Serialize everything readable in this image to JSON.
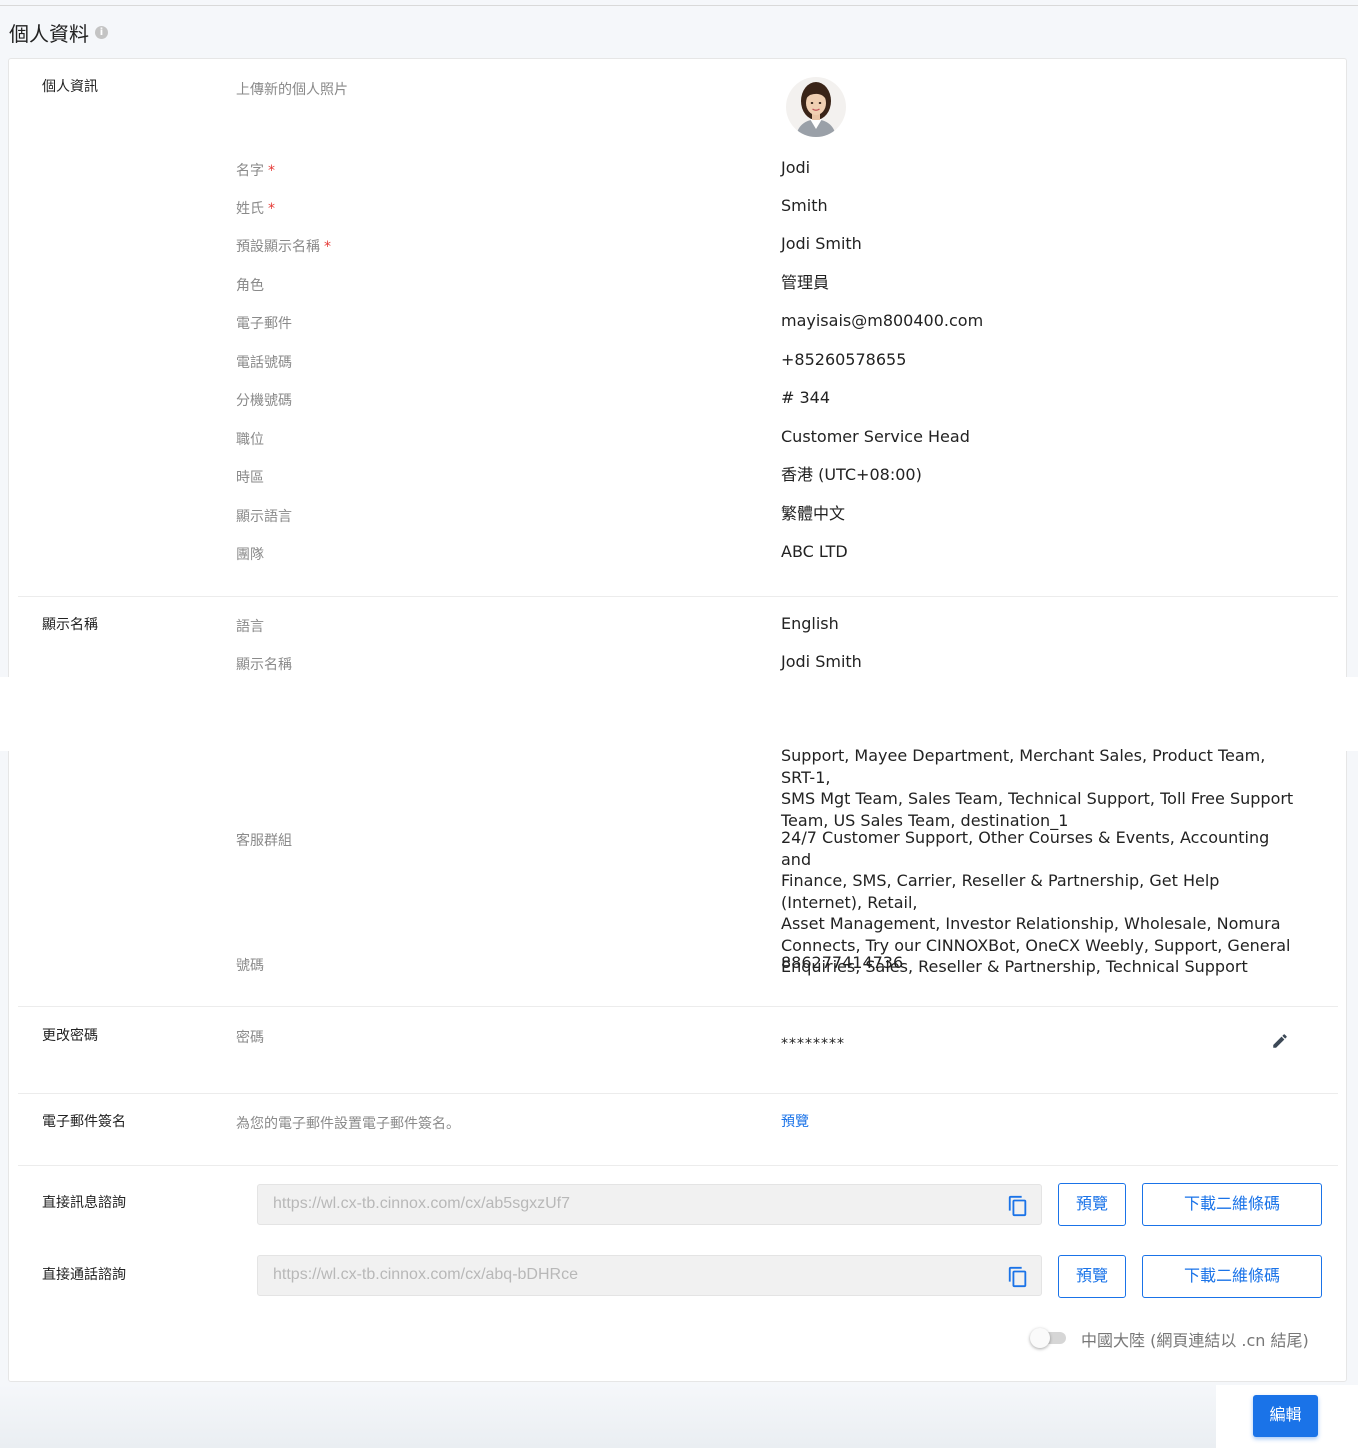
{
  "page": {
    "title": "個人資料"
  },
  "personal": {
    "section": "個人資訊",
    "photo_label": "上傳新的個人照片",
    "rows": [
      {
        "label": "名字",
        "value": "Jodi",
        "required": true
      },
      {
        "label": "姓氏",
        "value": "Smith",
        "required": true
      },
      {
        "label": "預設顯示名稱",
        "value": "Jodi Smith",
        "required": true
      },
      {
        "label": "角色",
        "value": "管理員",
        "required": false
      },
      {
        "label": "電子郵件",
        "value": "mayisais@m800400.com",
        "required": false
      },
      {
        "label": "電話號碼",
        "value": "+85260578655",
        "required": false
      },
      {
        "label": "分機號碼",
        "value": "# 344",
        "required": false
      },
      {
        "label": "職位",
        "value": "Customer Service Head",
        "required": false
      },
      {
        "label": "時區",
        "value": "香港 (UTC+08:00)",
        "required": false
      },
      {
        "label": "顯示語言",
        "value": "繁體中文",
        "required": false
      },
      {
        "label": "團隊",
        "value": "ABC LTD",
        "required": false
      }
    ],
    "required_mark": "*"
  },
  "display_name": {
    "section": "顯示名稱",
    "rows": [
      {
        "label": "語言",
        "value": "English"
      },
      {
        "label": "顯示名稱",
        "value": "Jodi Smith"
      }
    ]
  },
  "teams_continued": {
    "lines": [
      "Support, Mayee Department, Merchant Sales, Product Team, SRT-1,",
      "SMS Mgt Team, Sales Team, Technical Support, Toll Free Support",
      "Team, US Sales Team, destination_1"
    ]
  },
  "service_groups": {
    "label": "客服群組",
    "lines": [
      "24/7 Customer Support, Other Courses & Events, Accounting and",
      "Finance, SMS, Carrier, Reseller & Partnership, Get Help (Internet), Retail,",
      "Asset Management, Investor Relationship, Wholesale, Nomura",
      "Connects, Try our CINNOXBot, OneCX Weebly, Support, General",
      "Enquiries, Sales, Reseller & Partnership, Technical Support"
    ]
  },
  "number": {
    "label": "號碼",
    "value": "886277414736"
  },
  "password": {
    "section": "更改密碼",
    "label": "密碼",
    "value": "********",
    "edit_icon": "pencil-icon"
  },
  "signature": {
    "section": "電子郵件簽名",
    "description": "為您的電子郵件設置電子郵件簽名。",
    "preview": "預覽"
  },
  "direct_message": {
    "section": "直接訊息諮詢",
    "url": "https://wl.cx-tb.cinnox.com/cx/ab5sgxzUf7",
    "preview": "預覽",
    "download": "下載二維條碼",
    "copy_icon": "copy-icon"
  },
  "direct_call": {
    "section": "直接通話諮詢",
    "url": "https://wl.cx-tb.cinnox.com/cx/abq-bDHRce",
    "preview": "預覽",
    "download": "下載二維條碼",
    "copy_icon": "copy-icon"
  },
  "china_toggle": {
    "label": "中國大陸 (網頁連結以 .cn 結尾)",
    "on": false
  },
  "footer": {
    "edit": "編輯"
  },
  "colors": {
    "accent": "#1a73e8",
    "required": "#e53935",
    "label": "#8a8a8a"
  }
}
